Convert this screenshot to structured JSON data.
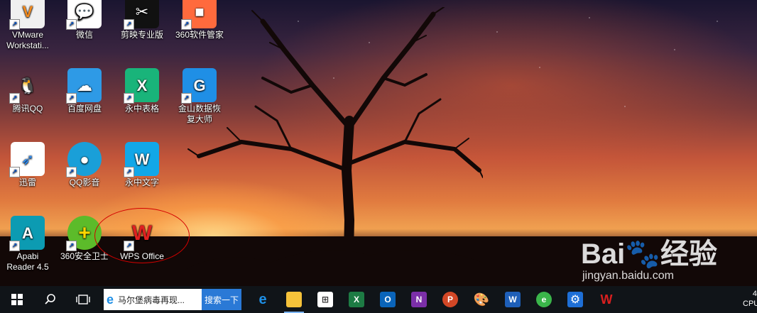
{
  "desktop_icons": [
    {
      "label": "VMware Workstati...",
      "glyph": "V",
      "bg": "#f0f0f0",
      "fg": "#f48a1c"
    },
    {
      "label": "微信",
      "glyph": "💬",
      "bg": "#ffffff",
      "fg": "#2dc100"
    },
    {
      "label": "剪映专业版",
      "glyph": "✂",
      "bg": "#111111",
      "fg": "#ffffff"
    },
    {
      "label": "360软件管家",
      "glyph": "■",
      "bg": "#ff6a3d",
      "fg": "#ffffff"
    },
    {
      "label": "腾讯QQ",
      "glyph": "🐧",
      "bg": "#ffffff",
      "fg": "#000000"
    },
    {
      "label": "百度网盘",
      "glyph": "☁",
      "bg": "#2e9ae6",
      "fg": "#ffffff"
    },
    {
      "label": "永中表格",
      "glyph": "X",
      "bg": "#19b47a",
      "fg": "#ffffff"
    },
    {
      "label": "金山数据恢复大师",
      "glyph": "G",
      "bg": "#1f8fe6",
      "fg": "#ffffff"
    },
    {
      "label": "迅雷",
      "glyph": "➶",
      "bg": "#ffffff",
      "fg": "#2b8bf2"
    },
    {
      "label": "QQ影音",
      "glyph": "●",
      "bg": "#1a9fd8",
      "fg": "#ffffff"
    },
    {
      "label": "永中文字",
      "glyph": "W",
      "bg": "#12a7e8",
      "fg": "#ffffff"
    },
    {
      "label": "Apabi Reader 4.5",
      "glyph": "A",
      "bg": "#0c9bb2",
      "fg": "#ffffff"
    },
    {
      "label": "360安全卫士",
      "glyph": "+",
      "bg": "#5cbb2a",
      "fg": "#ffd700"
    },
    {
      "label": "WPS Office",
      "glyph": "W",
      "bg": "#ffffff",
      "fg": "#e02020"
    }
  ],
  "watermark": {
    "brand": "Bai🐾经验",
    "url": "jingyan.baidu.com"
  },
  "taskbar": {
    "search_value": "马尔堡病毒再现...",
    "search_button": "搜索一下",
    "apps": [
      {
        "name": "edge",
        "glyph": "e",
        "color": "#1e8fe6"
      },
      {
        "name": "file-explorer",
        "glyph": "▆",
        "color": "#f5c23a"
      },
      {
        "name": "store",
        "glyph": "⊞",
        "color": "#5a5a5a"
      },
      {
        "name": "excel",
        "glyph": "X",
        "color": "#1d7b44"
      },
      {
        "name": "outlook",
        "glyph": "O",
        "color": "#0a64b9"
      },
      {
        "name": "onenote",
        "glyph": "N",
        "color": "#7b2fa8"
      },
      {
        "name": "powerpoint",
        "glyph": "P",
        "color": "#d24726"
      },
      {
        "name": "paint",
        "glyph": "🎨",
        "color": "#444444"
      },
      {
        "name": "word",
        "glyph": "W",
        "color": "#1e5fb8"
      },
      {
        "name": "360-browser",
        "glyph": "e",
        "color": "#3ab54a"
      },
      {
        "name": "settings",
        "glyph": "⚙",
        "color": "#1e6fd6"
      },
      {
        "name": "wps",
        "glyph": "W",
        "color": "#d91f1f"
      }
    ],
    "tray_top": "4",
    "tray_bottom": "CPU"
  }
}
